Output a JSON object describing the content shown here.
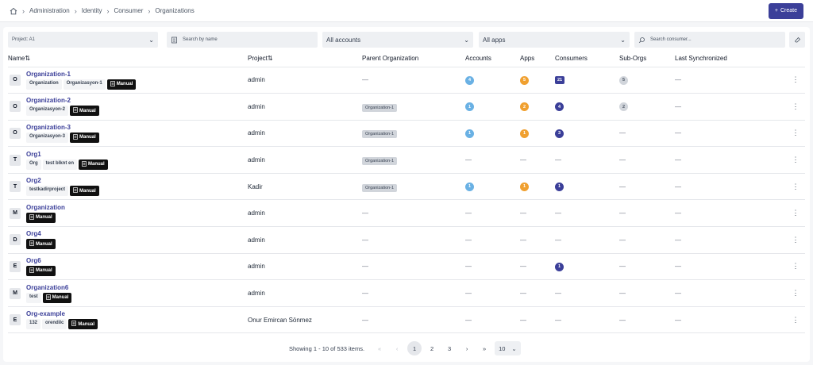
{
  "breadcrumb": [
    "Administration",
    "Identity",
    "Consumer",
    "Organizations"
  ],
  "create_label": "Create",
  "filters": {
    "project": "Project: A1",
    "search_name_placeholder": "Search by name",
    "accounts": "All accounts",
    "apps": "All apps",
    "search_consumer_placeholder": "Search consumer..."
  },
  "columns": {
    "name": "Name",
    "project": "Project",
    "parent": "Parent Organization",
    "accounts": "Accounts",
    "apps": "Apps",
    "consumers": "Consumers",
    "suborgs": "Sub-Orgs",
    "lastsync": "Last Synchronized"
  },
  "dash": "—",
  "rows": [
    {
      "avatar": "O",
      "name": "Organization-1",
      "tags": [
        "Organization",
        "Organizasyon-1"
      ],
      "manual": "Manual",
      "project": "admin",
      "parent": "",
      "accounts": "4",
      "apps": "5",
      "consumers": "21",
      "suborgs": "5",
      "lastsync": ""
    },
    {
      "avatar": "O",
      "name": "Organization-2",
      "tags": [
        "Organizasyon-2"
      ],
      "manual": "Manual",
      "project": "admin",
      "parent": "Organization-1",
      "accounts": "1",
      "apps": "2",
      "consumers": "4",
      "suborgs": "2",
      "lastsync": ""
    },
    {
      "avatar": "O",
      "name": "Organization-3",
      "tags": [
        "Organizasyon-3"
      ],
      "manual": "Manual",
      "project": "admin",
      "parent": "Organization-1",
      "accounts": "1",
      "apps": "1",
      "consumers": "3",
      "suborgs": "",
      "lastsync": ""
    },
    {
      "avatar": "T",
      "name": "Org1",
      "tags": [
        "Org",
        "test blknt en"
      ],
      "manual": "Manual",
      "project": "admin",
      "parent": "Organization-1",
      "accounts": "",
      "apps": "",
      "consumers": "",
      "suborgs": "",
      "lastsync": ""
    },
    {
      "avatar": "T",
      "name": "Org2",
      "tags": [
        "testkadirproject"
      ],
      "manual": "Manual",
      "project": "Kadir",
      "parent": "Organization-1",
      "accounts": "1",
      "apps": "1",
      "consumers": "1",
      "suborgs": "",
      "lastsync": ""
    },
    {
      "avatar": "M",
      "name": "Organization",
      "tags": [],
      "manual": "Manual",
      "project": "admin",
      "parent": "",
      "accounts": "",
      "apps": "",
      "consumers": "",
      "suborgs": "",
      "lastsync": ""
    },
    {
      "avatar": "D",
      "name": "Org4",
      "tags": [],
      "manual": "Manual",
      "project": "admin",
      "parent": "",
      "accounts": "",
      "apps": "",
      "consumers": "",
      "suborgs": "",
      "lastsync": ""
    },
    {
      "avatar": "E",
      "name": "Org6",
      "tags": [],
      "manual": "Manual",
      "project": "admin",
      "parent": "",
      "accounts": "",
      "apps": "",
      "consumers": "1",
      "suborgs": "",
      "lastsync": ""
    },
    {
      "avatar": "M",
      "name": "Organization6",
      "tags": [
        "test"
      ],
      "manual": "Manual",
      "project": "admin",
      "parent": "",
      "accounts": "",
      "apps": "",
      "consumers": "",
      "suborgs": "",
      "lastsync": ""
    },
    {
      "avatar": "E",
      "name": "Org-example",
      "tags": [
        "132",
        "orendilc"
      ],
      "manual": "Manual",
      "project": "Onur Emircan Sönmez",
      "parent": "",
      "accounts": "",
      "apps": "",
      "consumers": "",
      "suborgs": "",
      "lastsync": ""
    }
  ],
  "pagination": {
    "summary": "Showing 1 - 10 of 533 items.",
    "first": "«",
    "prev": "‹",
    "pages": [
      "1",
      "2",
      "3"
    ],
    "next": "›",
    "last": "»",
    "page_size": "10"
  },
  "icons": {
    "home": "home-icon",
    "doc": "document-icon",
    "search": "search-icon",
    "clear": "eraser-icon",
    "chevron": "chevron-down-icon",
    "sort": "sort-icon",
    "kebab": "more-vertical-icon"
  },
  "colors": {
    "primary": "#3b3f99",
    "accounts": "#6ab1e4",
    "apps": "#f0a030",
    "consumers": "#3b3f99",
    "suborgs": "#d1d5db"
  }
}
